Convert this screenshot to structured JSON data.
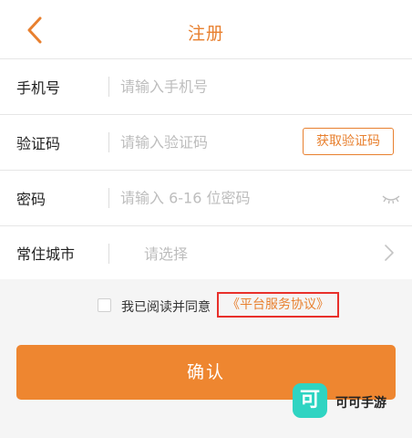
{
  "header": {
    "title": "注册",
    "back_icon": "chevron-left-icon"
  },
  "form": {
    "phone": {
      "label": "手机号",
      "placeholder": "请输入手机号"
    },
    "code": {
      "label": "验证码",
      "placeholder": "请输入验证码",
      "button": "获取验证码"
    },
    "password": {
      "label": "密码",
      "placeholder": "请输入 6-16 位密码",
      "toggle_icon": "eye-closed-icon"
    },
    "city": {
      "label": "常住城市",
      "placeholder": "请选择",
      "arrow_icon": "chevron-right-icon"
    }
  },
  "agreement": {
    "checked": false,
    "text": "我已阅读并同意",
    "link": "《平台服务协议》"
  },
  "confirm": {
    "label": "确认"
  },
  "watermark": {
    "logo_char": "可",
    "text": "可可手游"
  },
  "colors": {
    "accent": "#ee8630",
    "link": "#e8802f",
    "highlight_box": "#e8302b",
    "watermark_logo": "#2fd4c2"
  }
}
